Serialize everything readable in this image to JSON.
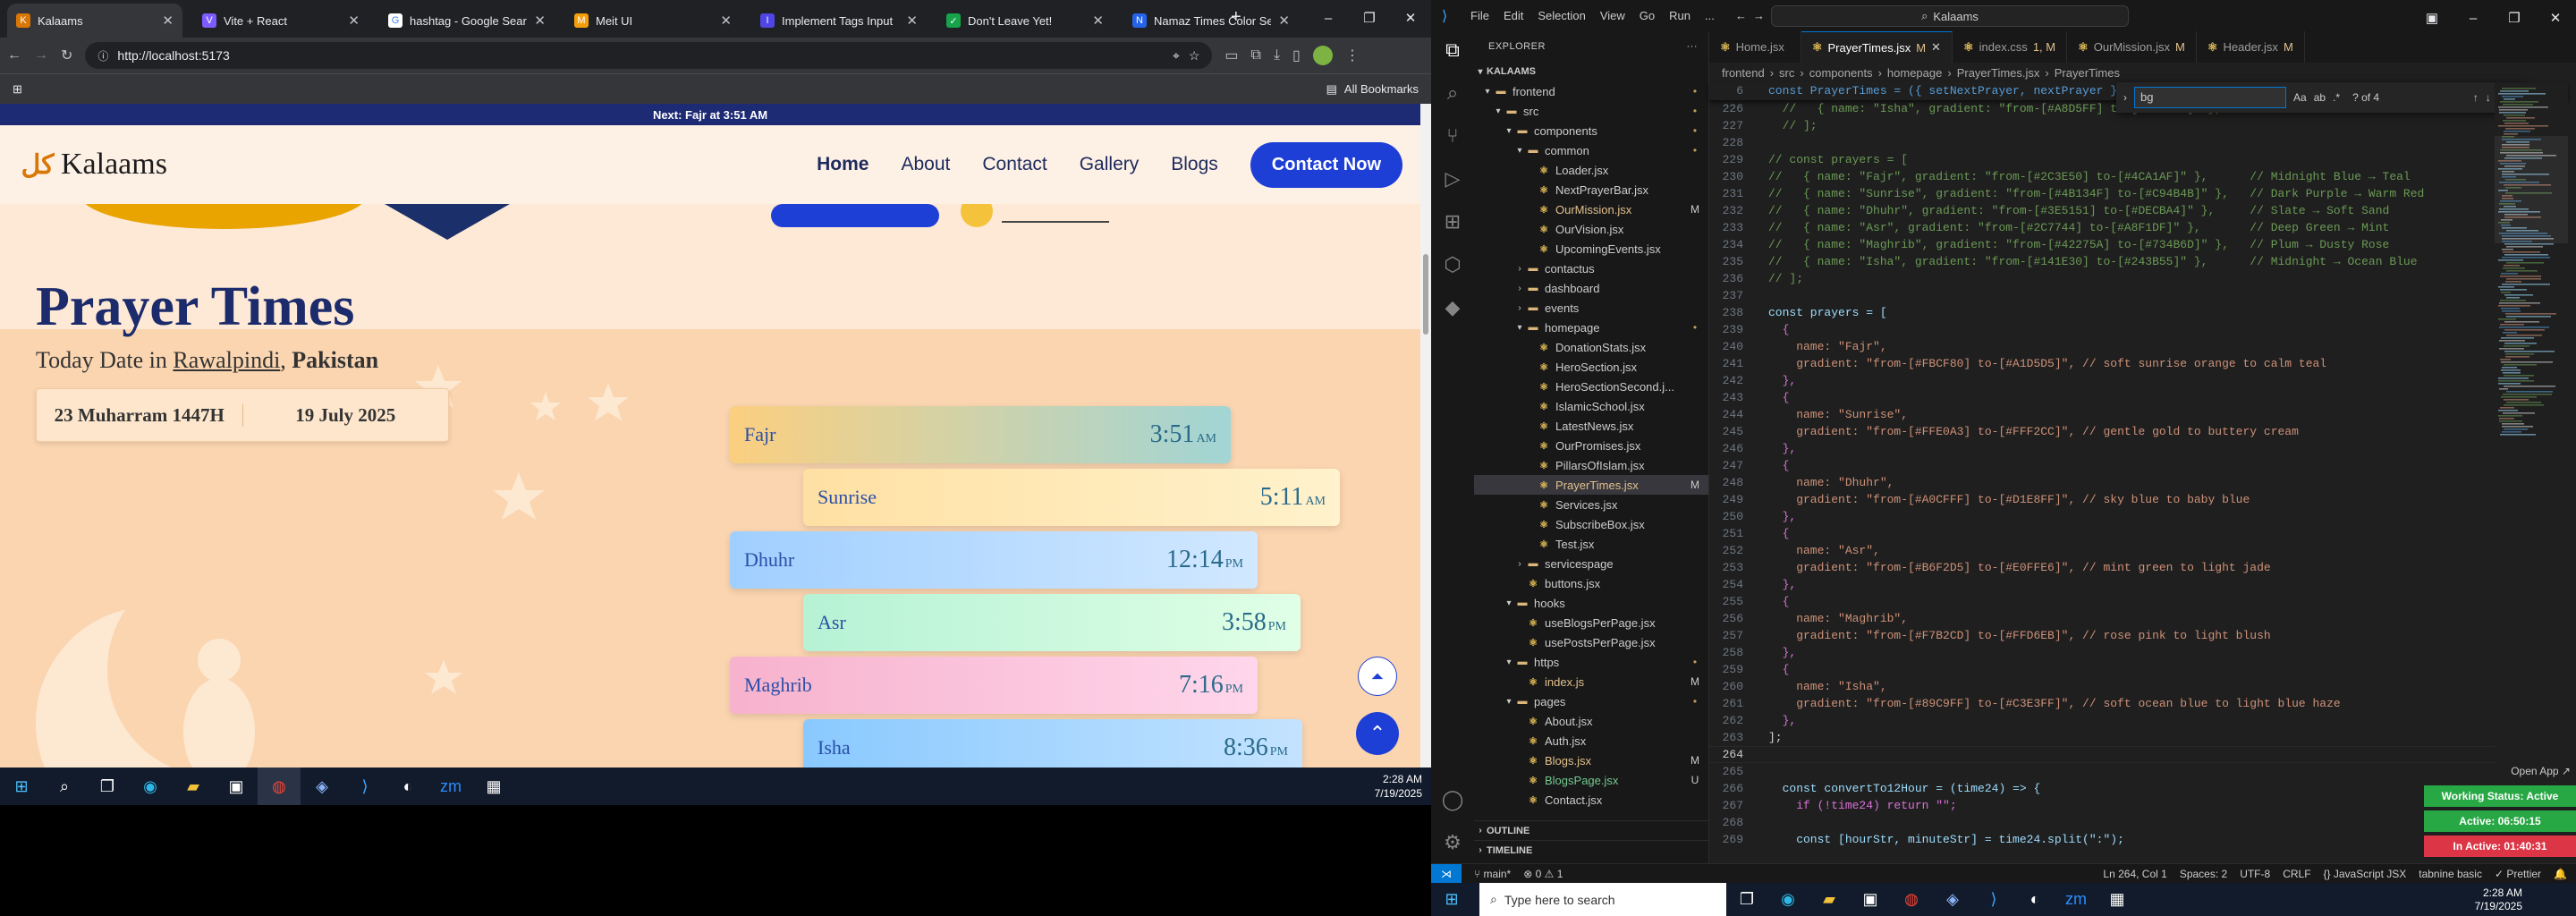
{
  "chrome": {
    "tabs": [
      {
        "title": "Kalaams",
        "icon_color": "#d97706",
        "glyph": "K",
        "active": true
      },
      {
        "title": "Vite + React",
        "icon_color": "#7c5cff",
        "glyph": "V",
        "active": false
      },
      {
        "title": "hashtag - Google Sear",
        "icon_color": "#ffffff",
        "glyph": "G",
        "active": false
      },
      {
        "title": "Meit UI",
        "icon_color": "#f59e0b",
        "glyph": "M",
        "active": false
      },
      {
        "title": "Implement Tags Input",
        "icon_color": "#4f46e5",
        "glyph": "I",
        "active": false
      },
      {
        "title": "Don't Leave Yet!",
        "icon_color": "#16a34a",
        "glyph": "✓",
        "active": false
      },
      {
        "title": "Namaz Times Color Se",
        "icon_color": "#2563eb",
        "glyph": "N",
        "active": false
      }
    ],
    "new_tab": "+",
    "url": "http://localhost:5173",
    "bookmarks_label": "All Bookmarks"
  },
  "website": {
    "banner": "Next: Fajr at 3:51 AM",
    "logo_text": "Kalaams",
    "nav": [
      "Home",
      "About",
      "Contact",
      "Gallery",
      "Blogs"
    ],
    "cta": "Contact Now",
    "section_title": "Prayer Times",
    "subtitle_prefix": "Today Date in ",
    "city": "Rawalpindi",
    "comma": ", ",
    "country": "Pakistan",
    "hijri_date": "23 Muharram 1447H",
    "gregorian_date": "19 July 2025",
    "prayers": [
      {
        "name": "Fajr",
        "time": "3:51",
        "ampm": "AM",
        "gradient_from": "#FBCF80",
        "gradient_to": "#A1D5D5"
      },
      {
        "name": "Sunrise",
        "time": "5:11",
        "ampm": "AM",
        "gradient_from": "#FFE0A3",
        "gradient_to": "#FFF2CC"
      },
      {
        "name": "Dhuhr",
        "time": "12:14",
        "ampm": "PM",
        "gradient_from": "#A0CFFF",
        "gradient_to": "#D1E8FF"
      },
      {
        "name": "Asr",
        "time": "3:58",
        "ampm": "PM",
        "gradient_from": "#B6F2D5",
        "gradient_to": "#E0FFE6"
      },
      {
        "name": "Maghrib",
        "time": "7:16",
        "ampm": "PM",
        "gradient_from": "#F7B2CD",
        "gradient_to": "#FFD6EB"
      },
      {
        "name": "Isha",
        "time": "8:36",
        "ampm": "PM",
        "gradient_from": "#89C9FF",
        "gradient_to": "#C3E3FF"
      }
    ]
  },
  "taskbar_left": {
    "time": "2:28 AM",
    "date": "7/19/2025"
  },
  "vscode": {
    "menu": [
      "File",
      "Edit",
      "Selection",
      "View",
      "Go",
      "Run",
      "..."
    ],
    "search": "Kalaams",
    "explorer_title": "EXPLORER",
    "root": "KALAAMS",
    "tree": [
      {
        "label": "frontend",
        "depth": 0,
        "type": "folder",
        "open": true,
        "status": "•"
      },
      {
        "label": "src",
        "depth": 1,
        "type": "folder",
        "open": true,
        "status": "•"
      },
      {
        "label": "components",
        "depth": 2,
        "type": "folder",
        "open": true,
        "status": "•"
      },
      {
        "label": "common",
        "depth": 3,
        "type": "folder",
        "open": true,
        "status": "•"
      },
      {
        "label": "Loader.jsx",
        "depth": 4,
        "type": "file",
        "status": ""
      },
      {
        "label": "NextPrayerBar.jsx",
        "depth": 4,
        "type": "file",
        "status": ""
      },
      {
        "label": "OurMission.jsx",
        "depth": 4,
        "type": "file",
        "status": "M",
        "mod": true
      },
      {
        "label": "OurVision.jsx",
        "depth": 4,
        "type": "file",
        "status": ""
      },
      {
        "label": "UpcomingEvents.jsx",
        "depth": 4,
        "type": "file",
        "status": ""
      },
      {
        "label": "contactus",
        "depth": 3,
        "type": "folder",
        "open": false,
        "status": ""
      },
      {
        "label": "dashboard",
        "depth": 3,
        "type": "folder",
        "open": false,
        "status": ""
      },
      {
        "label": "events",
        "depth": 3,
        "type": "folder",
        "open": false,
        "status": ""
      },
      {
        "label": "homepage",
        "depth": 3,
        "type": "folder",
        "open": true,
        "status": "•"
      },
      {
        "label": "DonationStats.jsx",
        "depth": 4,
        "type": "file",
        "status": ""
      },
      {
        "label": "HeroSection.jsx",
        "depth": 4,
        "type": "file",
        "status": ""
      },
      {
        "label": "HeroSectionSecond.j...",
        "depth": 4,
        "type": "file",
        "status": ""
      },
      {
        "label": "IslamicSchool.jsx",
        "depth": 4,
        "type": "file",
        "status": ""
      },
      {
        "label": "LatestNews.jsx",
        "depth": 4,
        "type": "file",
        "status": ""
      },
      {
        "label": "OurPromises.jsx",
        "depth": 4,
        "type": "file",
        "status": ""
      },
      {
        "label": "PillarsOfIslam.jsx",
        "depth": 4,
        "type": "file",
        "status": ""
      },
      {
        "label": "PrayerTimes.jsx",
        "depth": 4,
        "type": "file",
        "status": "M",
        "mod": true,
        "sel": true
      },
      {
        "label": "Services.jsx",
        "depth": 4,
        "type": "file",
        "status": ""
      },
      {
        "label": "SubscribeBox.jsx",
        "depth": 4,
        "type": "file",
        "status": ""
      },
      {
        "label": "Test.jsx",
        "depth": 4,
        "type": "file",
        "status": ""
      },
      {
        "label": "servicespage",
        "depth": 3,
        "type": "folder",
        "open": false,
        "status": ""
      },
      {
        "label": "buttons.jsx",
        "depth": 3,
        "type": "file",
        "status": ""
      },
      {
        "label": "hooks",
        "depth": 2,
        "type": "folder",
        "open": true,
        "status": ""
      },
      {
        "label": "useBlogsPerPage.jsx",
        "depth": 3,
        "type": "file",
        "status": ""
      },
      {
        "label": "usePostsPerPage.jsx",
        "depth": 3,
        "type": "file",
        "status": ""
      },
      {
        "label": "https",
        "depth": 2,
        "type": "folder",
        "open": true,
        "status": "•"
      },
      {
        "label": "index.js",
        "depth": 3,
        "type": "file",
        "status": "M",
        "mod": true
      },
      {
        "label": "pages",
        "depth": 2,
        "type": "folder",
        "open": true,
        "status": "•"
      },
      {
        "label": "About.jsx",
        "depth": 3,
        "type": "file",
        "status": ""
      },
      {
        "label": "Auth.jsx",
        "depth": 3,
        "type": "file",
        "status": ""
      },
      {
        "label": "Blogs.jsx",
        "depth": 3,
        "type": "file",
        "status": "M",
        "mod": true
      },
      {
        "label": "BlogsPage.jsx",
        "depth": 3,
        "type": "file",
        "status": "U",
        "unt": true
      },
      {
        "label": "Contact.jsx",
        "depth": 3,
        "type": "file",
        "status": ""
      }
    ],
    "outline": "OUTLINE",
    "timeline": "TIMELINE",
    "editor_tabs": [
      {
        "name": "Home.jsx",
        "status": "",
        "active": false
      },
      {
        "name": "PrayerTimes.jsx",
        "status": "M",
        "active": true
      },
      {
        "name": "index.css",
        "status": "1, M",
        "active": false
      },
      {
        "name": "OurMission.jsx",
        "status": "M",
        "active": false
      },
      {
        "name": "Header.jsx",
        "status": "M",
        "active": false
      }
    ],
    "breadcrumb": [
      "frontend",
      "src",
      "components",
      "homepage",
      "PrayerTimes.jsx",
      "PrayerTimes"
    ],
    "sticky_line_no": "6",
    "sticky_text": "const PrayerTimes = ({ setNextPrayer, nextPrayer }) => {",
    "find_query": "bg",
    "find_result": "? of 4",
    "code": [
      {
        "n": 226,
        "t": "  //   { name: \"Isha\", gradient: \"from-[#A8D5FF] to-[#C3E3FF]\" },",
        "k": "com"
      },
      {
        "n": 227,
        "t": "  // ];",
        "k": "com"
      },
      {
        "n": 228,
        "t": "",
        "k": "p"
      },
      {
        "n": 229,
        "t": "// const prayers = [",
        "k": "com"
      },
      {
        "n": 230,
        "t": "//   { name: \"Fajr\", gradient: \"from-[#2C3E50] to-[#4CA1AF]\" },      // Midnight Blue → Teal",
        "k": "com"
      },
      {
        "n": 231,
        "t": "//   { name: \"Sunrise\", gradient: \"from-[#4B134F] to-[#C94B4B]\" },   // Dark Purple → Warm Red",
        "k": "com"
      },
      {
        "n": 232,
        "t": "//   { name: \"Dhuhr\", gradient: \"from-[#3E5151] to-[#DECBA4]\" },     // Slate → Soft Sand",
        "k": "com"
      },
      {
        "n": 233,
        "t": "//   { name: \"Asr\", gradient: \"from-[#2C7744] to-[#A8F1DF]\" },       // Deep Green → Mint",
        "k": "com"
      },
      {
        "n": 234,
        "t": "//   { name: \"Maghrib\", gradient: \"from-[#42275A] to-[#734B6D]\" },   // Plum → Dusty Rose",
        "k": "com"
      },
      {
        "n": 235,
        "t": "//   { name: \"Isha\", gradient: \"from-[#141E30] to-[#243B55]\" },      // Midnight → Ocean Blue",
        "k": "com"
      },
      {
        "n": 236,
        "t": "// ];",
        "k": "com"
      },
      {
        "n": 237,
        "t": "",
        "k": "p"
      },
      {
        "n": 238,
        "t": "const prayers = [",
        "k": "decl"
      },
      {
        "n": 239,
        "t": "  {",
        "k": "br"
      },
      {
        "n": 240,
        "t": "    name: \"Fajr\",",
        "k": "prop"
      },
      {
        "n": 241,
        "t": "    gradient: \"from-[#FBCF80] to-[#A1D5D5]\", // soft sunrise orange to calm teal",
        "k": "prop"
      },
      {
        "n": 242,
        "t": "  },",
        "k": "br"
      },
      {
        "n": 243,
        "t": "  {",
        "k": "br"
      },
      {
        "n": 244,
        "t": "    name: \"Sunrise\",",
        "k": "prop"
      },
      {
        "n": 245,
        "t": "    gradient: \"from-[#FFE0A3] to-[#FFF2CC]\", // gentle gold to buttery cream",
        "k": "prop"
      },
      {
        "n": 246,
        "t": "  },",
        "k": "br"
      },
      {
        "n": 247,
        "t": "  {",
        "k": "br"
      },
      {
        "n": 248,
        "t": "    name: \"Dhuhr\",",
        "k": "prop"
      },
      {
        "n": 249,
        "t": "    gradient: \"from-[#A0CFFF] to-[#D1E8FF]\", // sky blue to baby blue",
        "k": "prop"
      },
      {
        "n": 250,
        "t": "  },",
        "k": "br"
      },
      {
        "n": 251,
        "t": "  {",
        "k": "br"
      },
      {
        "n": 252,
        "t": "    name: \"Asr\",",
        "k": "prop"
      },
      {
        "n": 253,
        "t": "    gradient: \"from-[#B6F2D5] to-[#E0FFE6]\", // mint green to light jade",
        "k": "prop"
      },
      {
        "n": 254,
        "t": "  },",
        "k": "br"
      },
      {
        "n": 255,
        "t": "  {",
        "k": "br"
      },
      {
        "n": 256,
        "t": "    name: \"Maghrib\",",
        "k": "prop"
      },
      {
        "n": 257,
        "t": "    gradient: \"from-[#F7B2CD] to-[#FFD6EB]\", // rose pink to light blush",
        "k": "prop"
      },
      {
        "n": 258,
        "t": "  },",
        "k": "br"
      },
      {
        "n": 259,
        "t": "  {",
        "k": "br"
      },
      {
        "n": 260,
        "t": "    name: \"Isha\",",
        "k": "prop"
      },
      {
        "n": 261,
        "t": "    gradient: \"from-[#89C9FF] to-[#C3E3FF]\", // soft ocean blue to light blue haze",
        "k": "prop"
      },
      {
        "n": 262,
        "t": "  },",
        "k": "br"
      },
      {
        "n": 263,
        "t": "];",
        "k": "p"
      },
      {
        "n": 264,
        "t": "",
        "k": "p",
        "cur": true
      },
      {
        "n": 265,
        "t": "",
        "k": "p"
      },
      {
        "n": 266,
        "t": "  const convertTo12Hour = (time24) => {",
        "k": "decl"
      },
      {
        "n": 267,
        "t": "    if (!time24) return \"\";",
        "k": "ctrl"
      },
      {
        "n": 268,
        "t": "",
        "k": "p"
      },
      {
        "n": 269,
        "t": "    const [hourStr, minuteStr] = time24.split(\":\");",
        "k": "decl"
      }
    ],
    "badges": {
      "open_app": "Open App ↗",
      "working": "Working Status: Active",
      "active": "Active: 06:50:15",
      "inactive": "In Active: 01:40:31"
    },
    "status": {
      "branch": "main*",
      "errors": "⊗ 0 ⚠ 1",
      "position": "Ln 264, Col 1",
      "spaces": "Spaces: 2",
      "encoding": "UTF-8",
      "eol": "CRLF",
      "language": "{} JavaScript JSX",
      "tabnine": "tabnine basic",
      "prettier": "✓ Prettier"
    }
  },
  "taskbar_right": {
    "search_placeholder": "Type here to search",
    "time": "2:28 AM",
    "date": "7/19/2025"
  },
  "colors": {
    "accent_blue": "#1e3fd6",
    "banner_navy": "#1d2a74",
    "working_green": "#28a745",
    "inactive_red": "#dc3545"
  }
}
